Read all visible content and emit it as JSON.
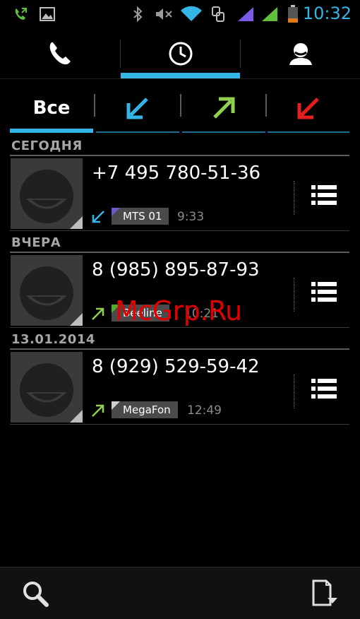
{
  "status_bar": {
    "time": "10:32",
    "icons": [
      "call-forward-icon",
      "gallery-icon",
      "bluetooth-icon",
      "mute-icon",
      "wifi-icon",
      "data-transfer-icon",
      "signal-sim1-icon",
      "signal-sim2-icon",
      "battery-icon"
    ],
    "accent_color": "#33b5e5"
  },
  "top_tabs": {
    "items": [
      "phone-icon",
      "clock-icon",
      "contacts-icon"
    ],
    "selected_index": 1
  },
  "filter_tabs": {
    "all_label": "Все",
    "items": [
      "all",
      "incoming-icon",
      "outgoing-icon",
      "missed-icon"
    ],
    "selected_index": 0,
    "colors": {
      "incoming": "#33b5e5",
      "outgoing": "#8fd14f",
      "missed": "#e61e1e"
    }
  },
  "sections": [
    {
      "title": "СЕГОДНЯ",
      "calls": [
        {
          "number": "+7 495 780-51-36",
          "type": "incoming",
          "sim": "MTS 01",
          "sim_color": "#6a5acd",
          "time": "9:33"
        }
      ]
    },
    {
      "title": "ВЧЕРА",
      "calls": [
        {
          "number": "8 (985) 895-87-93",
          "type": "outgoing",
          "sim": "Beeline",
          "sim_color": "#4caf27",
          "time": "10:21"
        }
      ]
    },
    {
      "title": "13.01.2014",
      "calls": [
        {
          "number": "8 (929) 529-59-42",
          "type": "outgoing",
          "sim": "MegaFon",
          "sim_color": "#d0d0d0",
          "time": "12:49"
        }
      ]
    }
  ],
  "watermark": "McGrp.Ru",
  "bottom_bar": {
    "items": [
      "search-icon",
      "save-log-icon"
    ]
  }
}
